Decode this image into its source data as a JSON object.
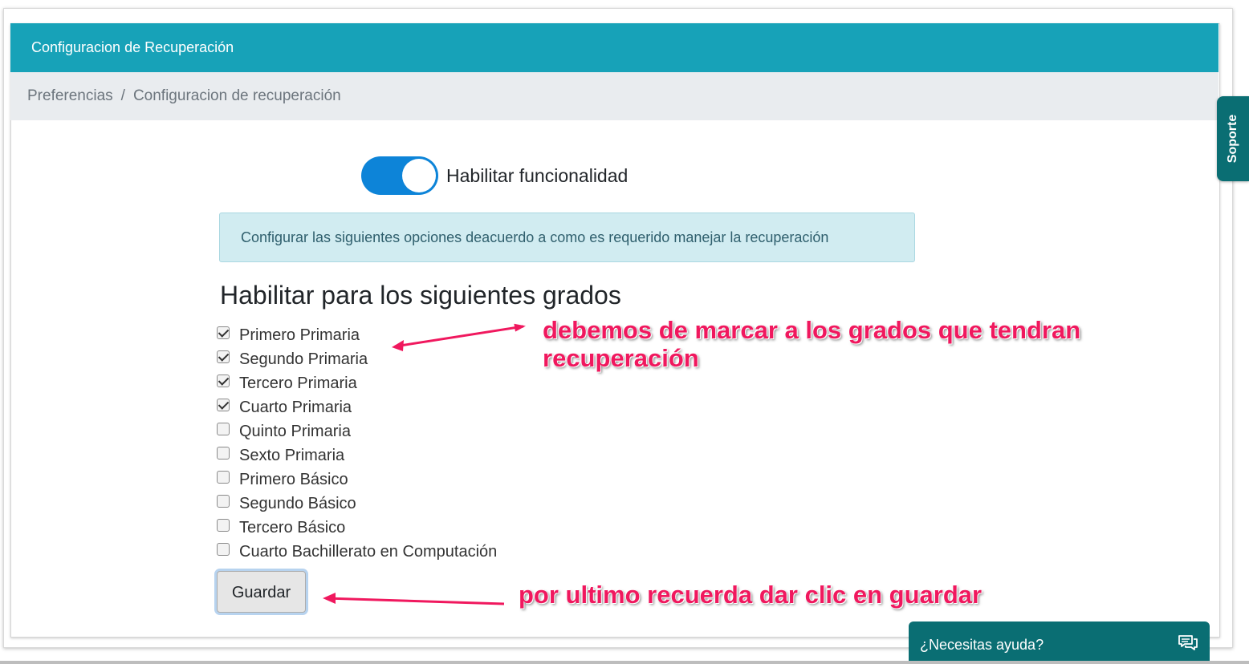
{
  "panel": {
    "title": "Configuracion de Recuperación",
    "breadcrumb": {
      "item1": "Preferencias",
      "separator": "/",
      "item2": "Configuracion de recuperación"
    }
  },
  "toggle": {
    "label": "Habilitar funcionalidad",
    "checked": true
  },
  "alert": {
    "text": "Configurar las siguientes opciones deacuerdo a como es requerido manejar la recuperación"
  },
  "grades_section": {
    "title": "Habilitar para los siguientes grados",
    "items": [
      {
        "label": "Primero Primaria",
        "checked": true
      },
      {
        "label": "Segundo Primaria",
        "checked": true
      },
      {
        "label": "Tercero Primaria",
        "checked": true
      },
      {
        "label": "Cuarto Primaria",
        "checked": true
      },
      {
        "label": "Quinto Primaria",
        "checked": false
      },
      {
        "label": "Sexto Primaria",
        "checked": false
      },
      {
        "label": "Primero Básico",
        "checked": false
      },
      {
        "label": "Segundo Básico",
        "checked": false
      },
      {
        "label": "Tercero Básico",
        "checked": false
      },
      {
        "label": "Cuarto Bachillerato en Computación",
        "checked": false
      }
    ]
  },
  "save_button": {
    "label": "Guardar"
  },
  "annotations": {
    "note1_line1": "debemos de marcar a los grados que tendran",
    "note1_line2": "recuperación",
    "note2": "por ultimo recuerda dar clic en guardar"
  },
  "support_tab": {
    "label": "Soporte"
  },
  "help_widget": {
    "text": "¿Necesitas ayuda?",
    "icon": "chat-bubbles-icon"
  },
  "colors": {
    "header": "#17a2b8",
    "breadcrumb_bg": "#e9ecef",
    "toggle_on": "#0d84d8",
    "alert_bg": "#d1ecf1",
    "annotation": "#f0185e",
    "support_teal": "#0a6e73"
  }
}
